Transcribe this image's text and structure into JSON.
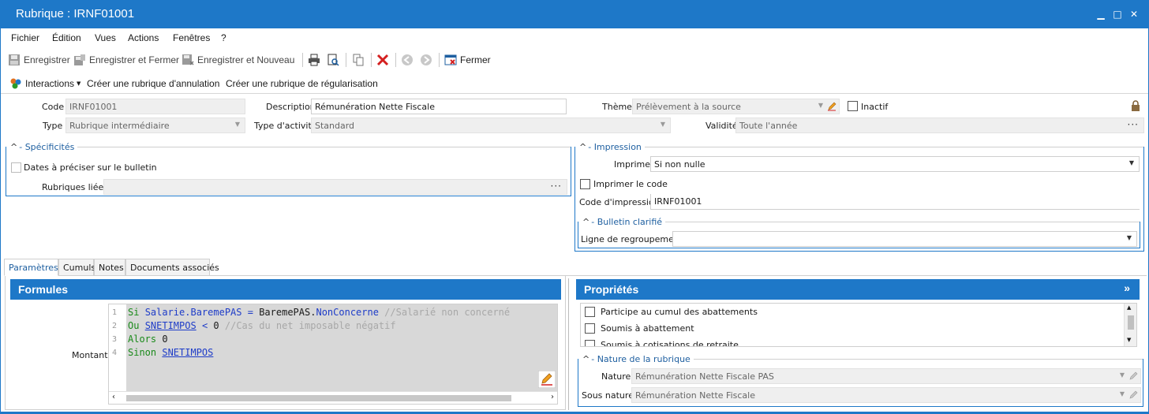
{
  "window": {
    "title": "Rubrique : IRNF01001",
    "controls": [
      "minimize-icon",
      "maximize-icon",
      "close-icon"
    ]
  },
  "menu": [
    "Fichier",
    "Édition",
    "Vues",
    "Actions",
    "Fenêtres",
    "?"
  ],
  "toolbar": {
    "save": "Enregistrer",
    "save_close": "Enregistrer et Fermer",
    "save_new": "Enregistrer et Nouveau",
    "close": "Fermer"
  },
  "actionbar": {
    "interactions": "Interactions",
    "cancel_rubric": "Créer une rubrique d'annulation",
    "regul_rubric": "Créer une rubrique de régularisation"
  },
  "form": {
    "code_label": "Code",
    "code_value": "IRNF01001",
    "description_label": "Description",
    "description_value": "Rémunération Nette Fiscale",
    "theme_label": "Thème",
    "theme_value": "Prélèvement à la source",
    "inactive_label": "Inactif",
    "type_label": "Type",
    "type_value": "Rubrique intermédiaire",
    "activity_label": "Type d'activité",
    "activity_value": "Standard",
    "validity_label": "Validité",
    "validity_value": "Toute l'année"
  },
  "specificites": {
    "title": "Spécificités",
    "dates_label": "Dates à préciser sur le bulletin",
    "linked_label": "Rubriques liées",
    "linked_value": ""
  },
  "impression": {
    "title": "Impression",
    "print_label": "Imprimer",
    "print_value": "Si non nulle",
    "print_code_label": "Imprimer le code",
    "code_label": "Code d'impression",
    "code_value": "IRNF01001",
    "bulletin_title": "Bulletin clarifié",
    "regroup_label": "Ligne de regroupement",
    "regroup_value": ""
  },
  "tabs": [
    "Paramètres",
    "Cumuls",
    "Notes",
    "Documents associés"
  ],
  "formules": {
    "title": "Formules",
    "amount_label": "Montant",
    "line_numbers": [
      "1",
      "2",
      "3",
      "4"
    ],
    "lines": [
      [
        {
          "t": "Si ",
          "c": "kw"
        },
        {
          "t": "Salarie.BaremePAS",
          "c": "id"
        },
        {
          "t": " = ",
          "c": "op"
        },
        {
          "t": "BaremePAS",
          "c": "plain"
        },
        {
          "t": ".",
          "c": "plain"
        },
        {
          "t": "NonConcerne",
          "c": "id"
        },
        {
          "t": " //Salarié non concerné",
          "c": "cm"
        }
      ],
      [
        {
          "t": "Ou ",
          "c": "kw"
        },
        {
          "t": "SNETIMPOS",
          "c": "lnk"
        },
        {
          "t": " < ",
          "c": "op"
        },
        {
          "t": "0",
          "c": "plain"
        },
        {
          "t": " //Cas du net imposable négatif",
          "c": "cm"
        }
      ],
      [
        {
          "t": "Alors ",
          "c": "kw"
        },
        {
          "t": "0",
          "c": "plain"
        }
      ],
      [
        {
          "t": "Sinon ",
          "c": "kw"
        },
        {
          "t": "SNETIMPOS",
          "c": "lnk"
        }
      ]
    ]
  },
  "proprietes": {
    "title": "Propriétés",
    "items": [
      "Participe au cumul des abattements",
      "Soumis à abattement",
      "Soumis à cotisations de retraite"
    ],
    "nature_title": "Nature de la rubrique",
    "nature_label": "Nature",
    "nature_value": "Rémunération Nette Fiscale PAS",
    "subnature_label": "Sous nature",
    "subnature_value": "Rémunération Nette Fiscale"
  },
  "colors": {
    "accent": "#1e78c8",
    "keyword": "#1a8a1a",
    "identifier": "#1e3cc8",
    "comment": "#a8a8a8",
    "close_red": "#d42020"
  }
}
